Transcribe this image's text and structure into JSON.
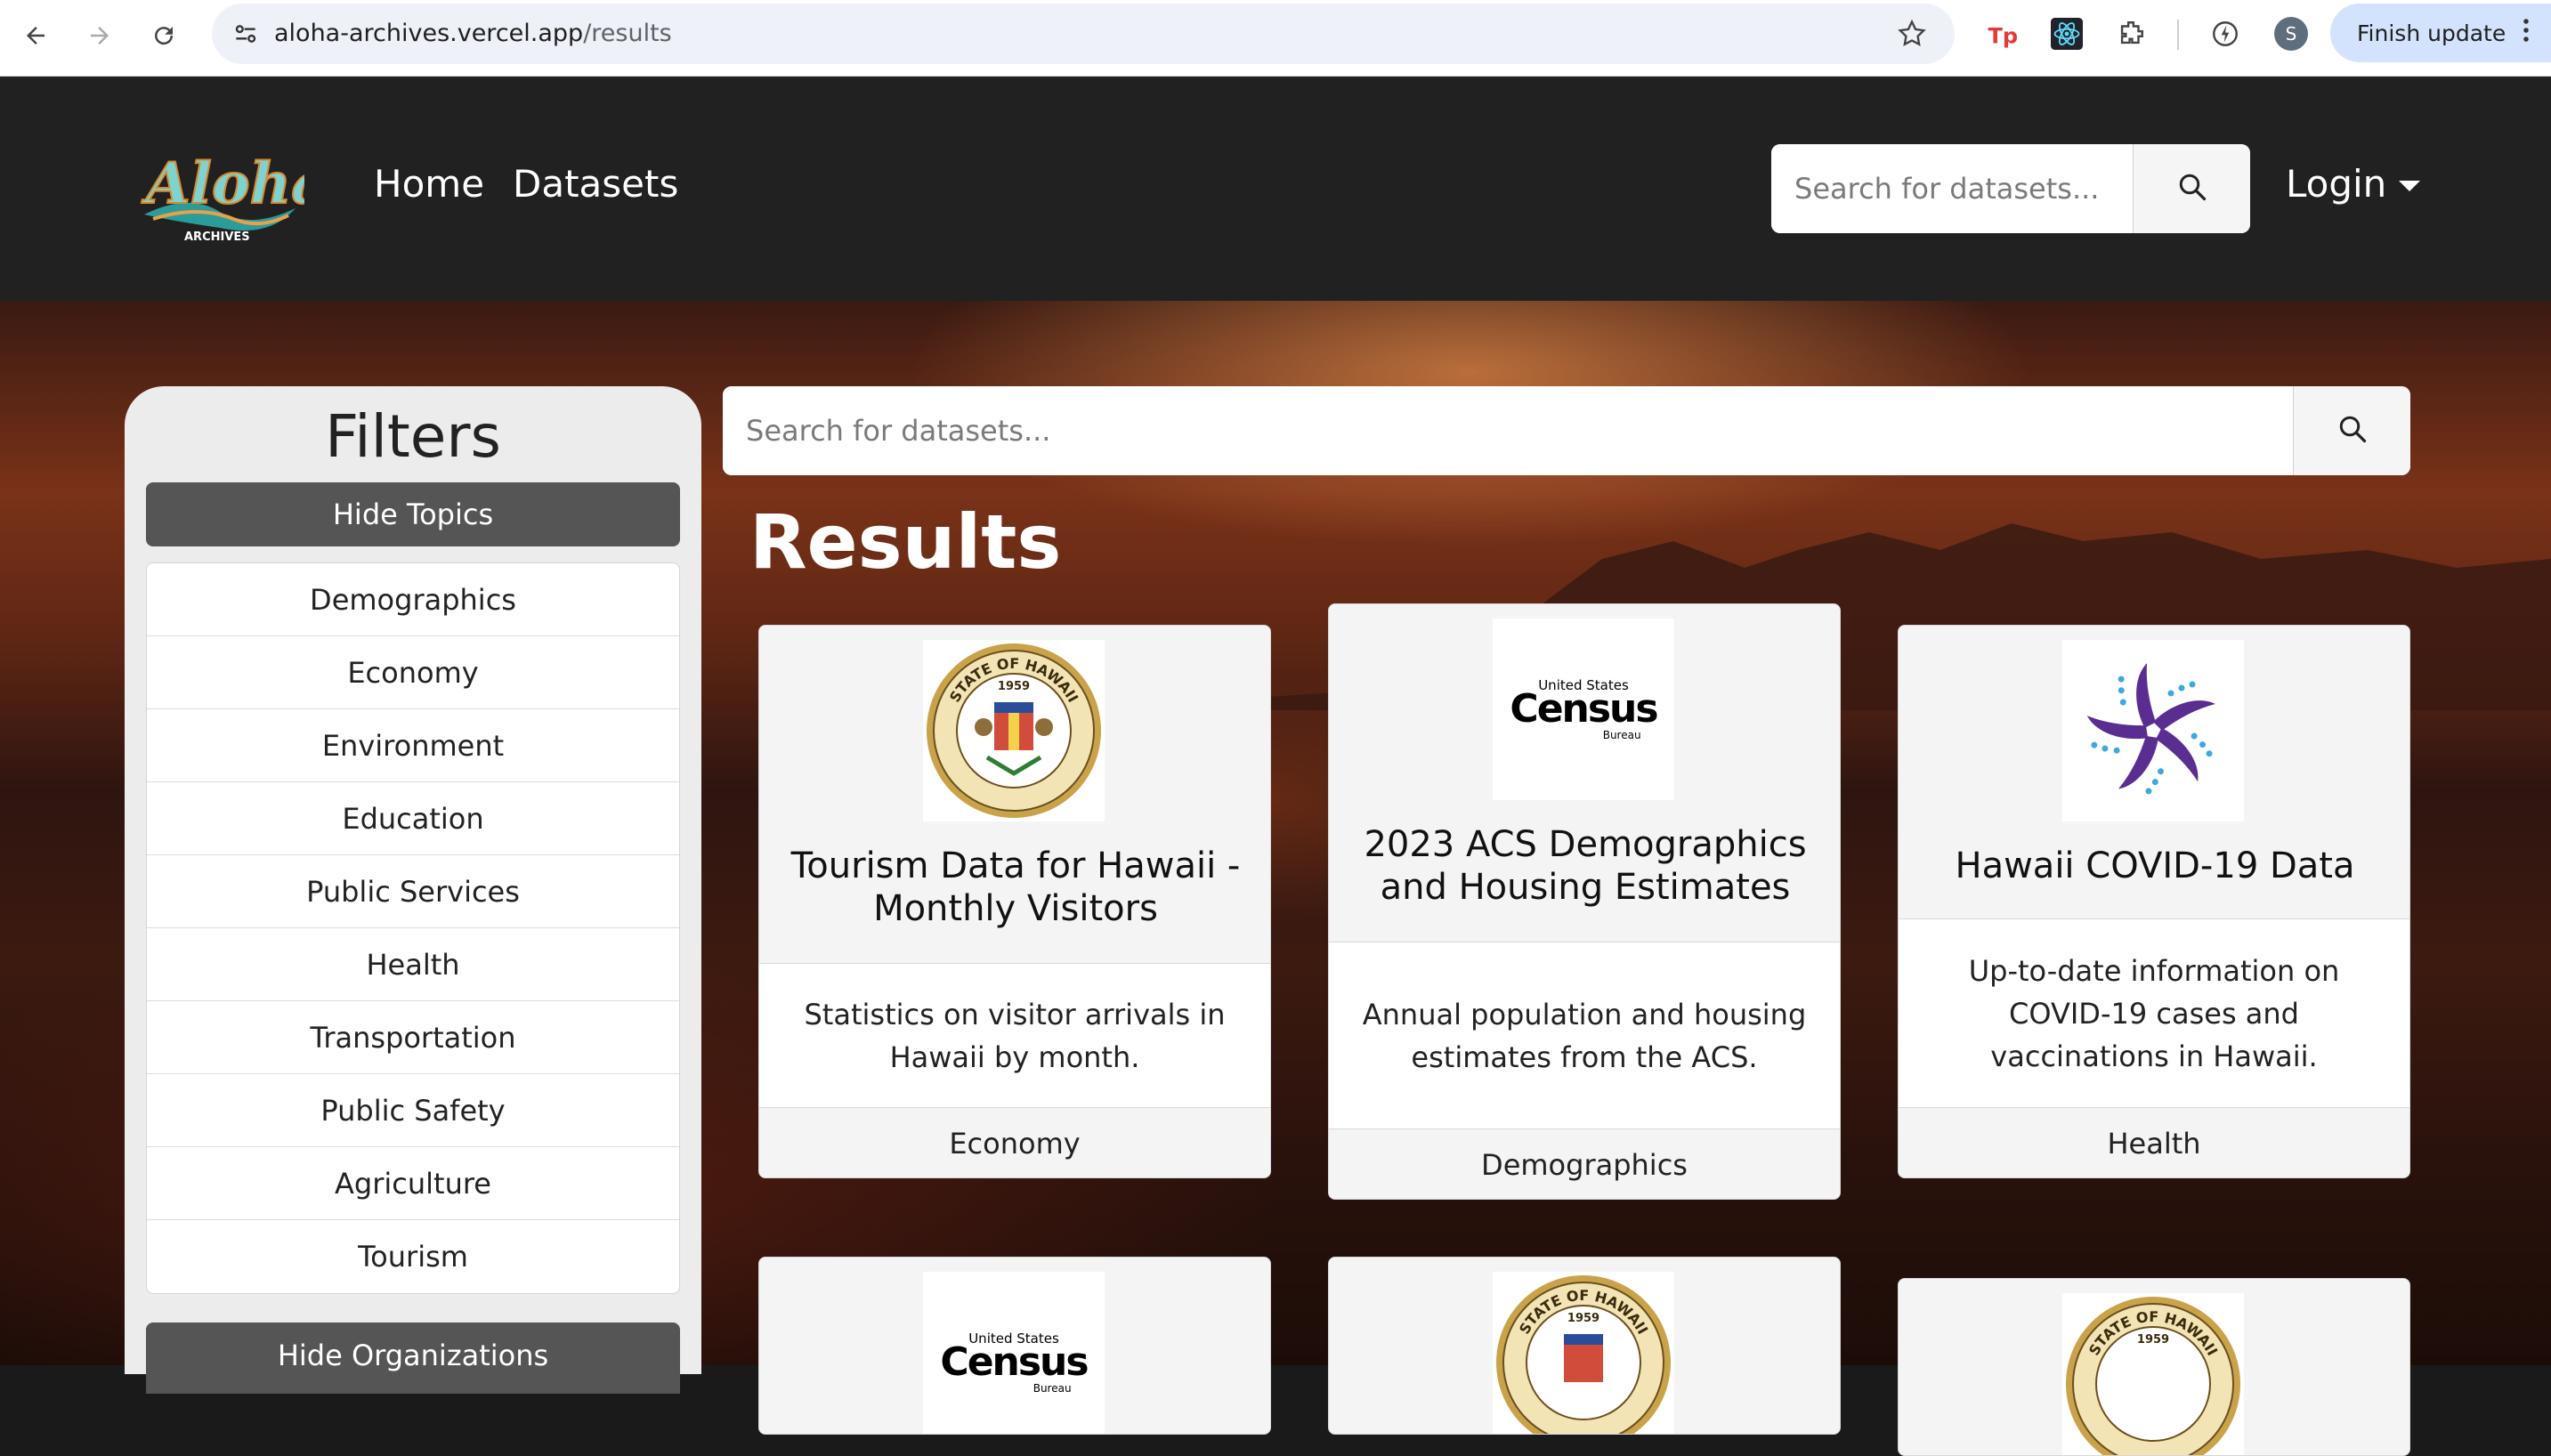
{
  "browser": {
    "url_domain": "aloha-archives.vercel.app",
    "url_path": "/results",
    "profile_initial": "S",
    "finish_update_label": "Finish update"
  },
  "navbar": {
    "logo_text": "Aloha",
    "logo_subtext": "ARCHIVES",
    "links": [
      "Home",
      "Datasets"
    ],
    "search_placeholder": "Search for datasets...",
    "login_label": "Login"
  },
  "filters": {
    "title": "Filters",
    "hide_topics_label": "Hide Topics",
    "topics": [
      "Demographics",
      "Economy",
      "Environment",
      "Education",
      "Public Services",
      "Health",
      "Transportation",
      "Public Safety",
      "Agriculture",
      "Tourism"
    ],
    "hide_orgs_label": "Hide Organizations"
  },
  "main": {
    "search_placeholder": "Search for datasets...",
    "results_title": "Results"
  },
  "cards": [
    {
      "title": "Tourism Data for Hawaii - Monthly Visitors",
      "description": "Statistics on visitor arrivals in Hawaii by month.",
      "topic": "Economy",
      "logo": "hawaii-state-seal"
    },
    {
      "title": "2023 ACS Demographics and Housing Estimates",
      "description": "Annual population and housing estimates from the ACS.",
      "topic": "Demographics",
      "logo": "census-bureau"
    },
    {
      "title": "Hawaii COVID-19 Data",
      "description": "Up-to-date information on COVID-19 cases and vaccinations in Hawaii.",
      "topic": "Health",
      "logo": "hawaii-health-flower"
    },
    {
      "logo": "census-bureau"
    },
    {
      "logo": "hawaii-state-seal"
    },
    {
      "logo": "hawaii-state-seal"
    }
  ],
  "logos": {
    "seal_top_text": "STATE OF HAWAII",
    "seal_year": "1959",
    "census_line1": "United States",
    "census_line2": "Census",
    "census_line3": "Bureau"
  },
  "colors": {
    "navbar_bg": "#212121",
    "hero_accent": "#7a3218",
    "filters_bg": "#ececec",
    "toggle_bg": "#555555",
    "finish_update_bg": "#d3e3fd"
  }
}
